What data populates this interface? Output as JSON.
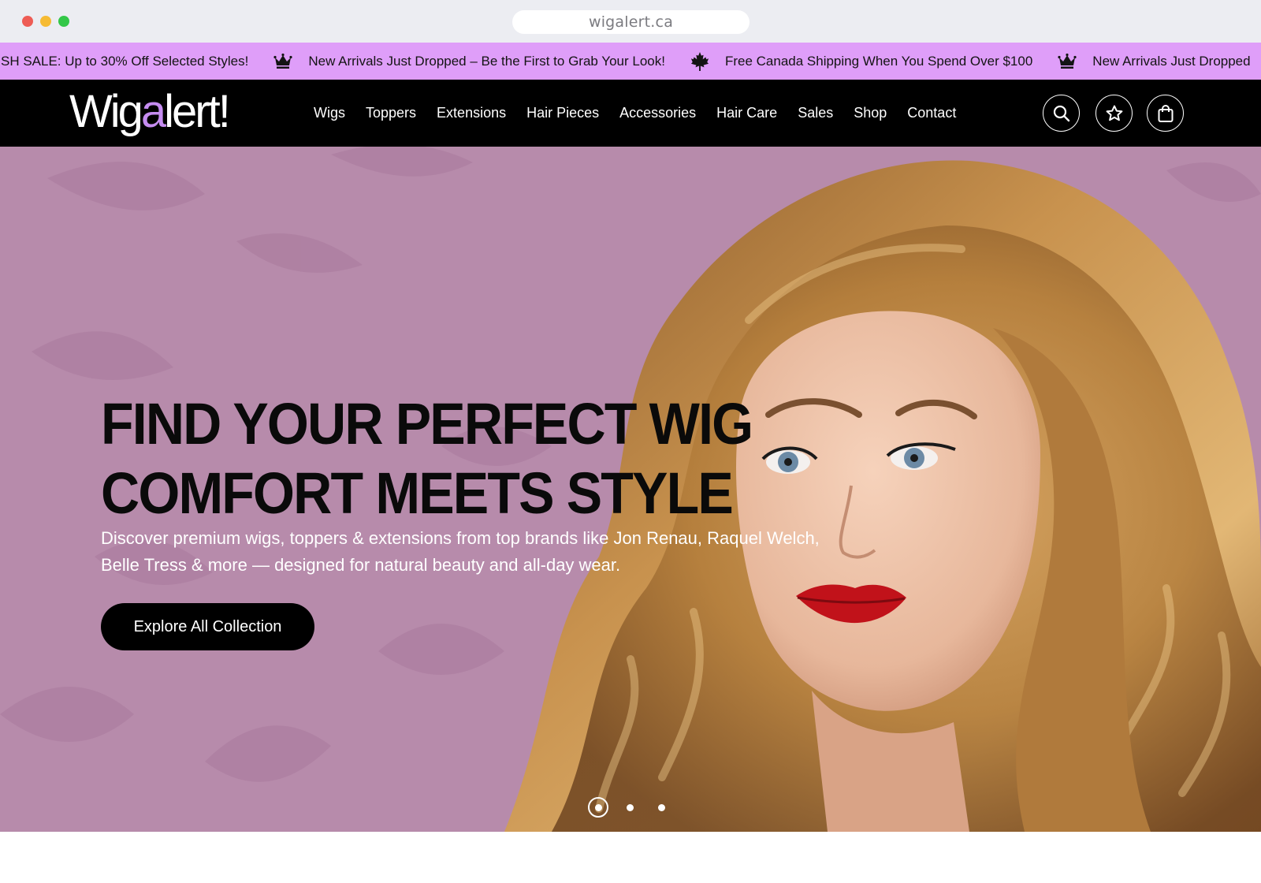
{
  "browser": {
    "url": "wigalert.ca"
  },
  "ticker": {
    "items": [
      {
        "text": "SH SALE: Up to 30% Off Selected Styles!",
        "icon": "crown-icon"
      },
      {
        "text": "New Arrivals Just Dropped – Be the First to Grab Your Look!",
        "icon": "maple-leaf-icon"
      },
      {
        "text": "Free Canada Shipping When You Spend Over $100",
        "icon": "crown-icon"
      },
      {
        "text": "New Arrivals Just Dropped",
        "icon": ""
      }
    ],
    "background": "#df9ef9"
  },
  "header": {
    "logo": {
      "part1": "Wig",
      "accent": "a",
      "part2": "lert!"
    },
    "nav": [
      "Wigs",
      "Toppers",
      "Extensions",
      "Hair Pieces",
      "Accessories",
      "Hair Care",
      "Sales",
      "Shop",
      "Contact"
    ],
    "icons": [
      "search-icon",
      "star-icon",
      "shopping-bag-icon"
    ]
  },
  "hero": {
    "title_line1": "FIND YOUR PERFECT WIG",
    "title_line2": "COMFORT MEETS STYLE",
    "subtitle_line1": "Discover premium wigs, toppers & extensions from top brands like Jon Renau, Raquel Welch,",
    "subtitle_line2": "Belle Tress & more — designed for natural beauty and all-day wear.",
    "cta": "Explore All Collection",
    "slides": 3,
    "active_slide": 1,
    "background": "#b78bab"
  }
}
